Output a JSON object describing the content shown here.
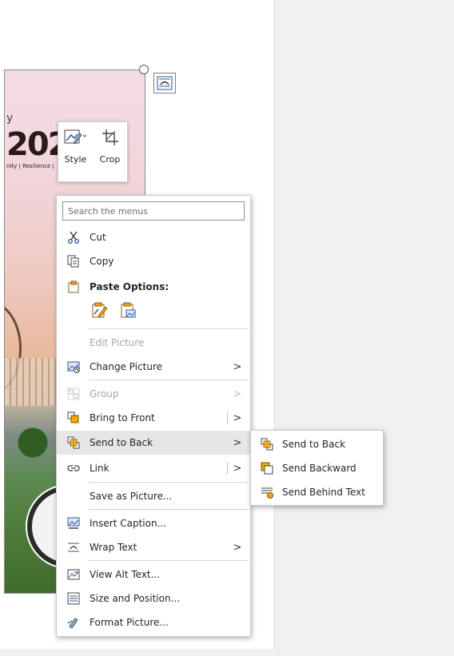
{
  "picture": {
    "text_fragment_y": "y",
    "logo_text": "202",
    "tagline": "nity | Resilience |"
  },
  "mini_toolbar": {
    "style_label": "Style",
    "crop_label": "Crop"
  },
  "context_menu": {
    "search_placeholder": "Search the menus",
    "items": [
      {
        "key": "cut",
        "label": "Cut",
        "enabled": true
      },
      {
        "key": "copy",
        "label": "Copy",
        "enabled": true
      },
      {
        "key": "paste_options",
        "label": "Paste Options:",
        "enabled": true
      },
      {
        "key": "edit_picture",
        "label": "Edit Picture",
        "enabled": false
      },
      {
        "key": "change_picture",
        "label": "Change Picture",
        "enabled": true,
        "submenu": true
      },
      {
        "key": "group",
        "label": "Group",
        "enabled": false,
        "submenu": true
      },
      {
        "key": "bring_to_front",
        "label": "Bring to Front",
        "enabled": true,
        "submenu": true
      },
      {
        "key": "send_to_back",
        "label": "Send to Back",
        "enabled": true,
        "submenu": true,
        "highlighted": true
      },
      {
        "key": "link",
        "label": "Link",
        "enabled": true,
        "submenu": true
      },
      {
        "key": "save_as_picture",
        "label": "Save as Picture...",
        "enabled": true
      },
      {
        "key": "insert_caption",
        "label": "Insert Caption...",
        "enabled": true
      },
      {
        "key": "wrap_text",
        "label": "Wrap Text",
        "enabled": true,
        "submenu": true
      },
      {
        "key": "view_alt_text",
        "label": "View Alt Text...",
        "enabled": true
      },
      {
        "key": "size_and_position",
        "label": "Size and Position...",
        "enabled": true
      },
      {
        "key": "format_picture",
        "label": "Format Picture...",
        "enabled": true
      }
    ]
  },
  "submenu": {
    "items": [
      {
        "label": "Send to Back"
      },
      {
        "label": "Send Backward"
      },
      {
        "label": "Send Behind Text"
      }
    ]
  },
  "colors": {
    "accent_orange": "#f2a900",
    "accent_blue": "#2b579a",
    "hover_bg": "#e6e6e6"
  }
}
